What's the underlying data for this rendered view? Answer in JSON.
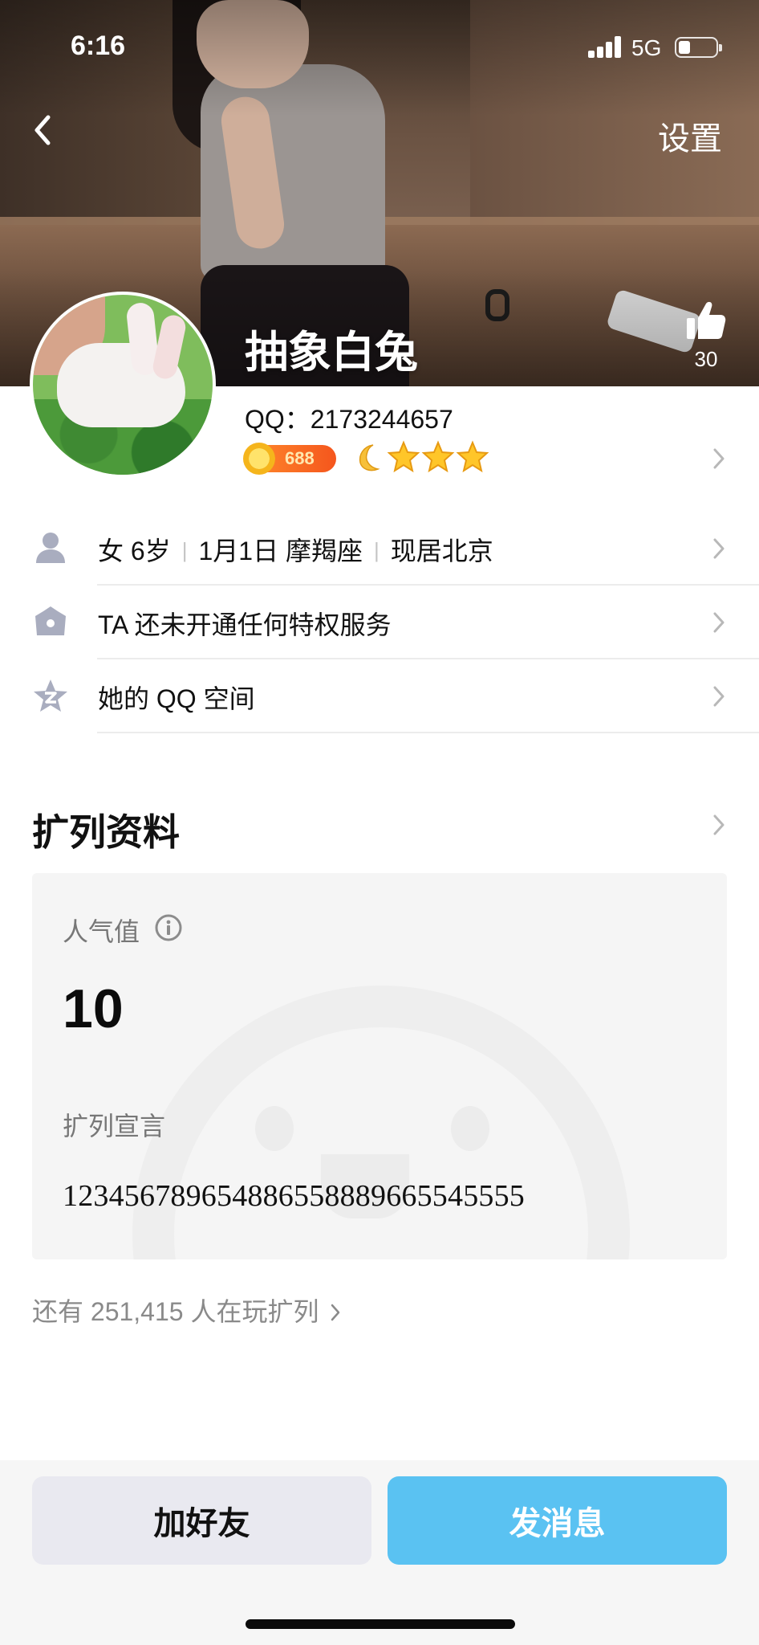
{
  "status_bar": {
    "time": "6:16",
    "network": "5G"
  },
  "nav": {
    "settings_label": "设置"
  },
  "profile": {
    "nickname": "抽象白兔",
    "qq_label": "QQ：",
    "qq_number": "2173244657",
    "likes": "30",
    "coin_level": "688"
  },
  "info_rows": [
    {
      "gender_age": "女 6岁",
      "birthday_sign": "1月1日 摩羯座",
      "location": "现居北京"
    },
    {
      "label": "TA 还未开通任何特权服务"
    },
    {
      "label": "她的 QQ 空间"
    }
  ],
  "extended": {
    "title": "扩列资料",
    "popularity_label": "人气值",
    "popularity_value": "10",
    "declaration_label": "扩列宣言",
    "declaration_text": "123456789654886558889665545555",
    "players_text": "还有 251,415 人在玩扩列"
  },
  "actions": {
    "add_friend": "加好友",
    "send_message": "发消息"
  },
  "colors": {
    "accent": "#5ac2f2",
    "add_button_bg": "#e9e9f0",
    "coin_orange": "#f5561d",
    "star_gold": "#ffc629"
  },
  "icons": [
    "back-icon",
    "thumbs-up-icon",
    "person-icon",
    "crown-icon",
    "qzone-star-icon",
    "chevron-right-icon",
    "info-icon",
    "moon-icon",
    "star-icon",
    "coin-icon"
  ]
}
